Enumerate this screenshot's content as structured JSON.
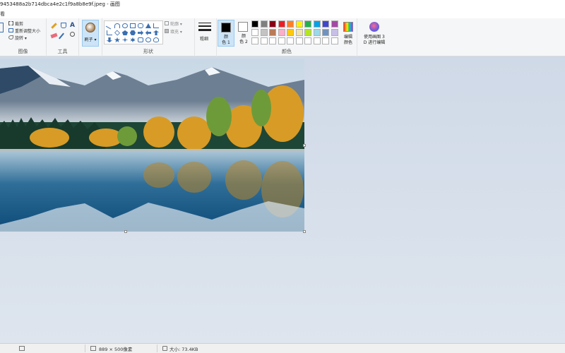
{
  "window": {
    "title": "9453488a2b714dbca4e2c1f9a8b8e9f.jpeg - 画图"
  },
  "menu": {
    "file_label": "看"
  },
  "ribbon": {
    "image_group": {
      "label": "图像",
      "crop": "裁剪",
      "resize": "重新调整大小",
      "rotate": "旋转"
    },
    "tools_group": {
      "label": "工具"
    },
    "brush": {
      "label": "刷子"
    },
    "shapes_group": {
      "label": "形状",
      "outline": "轮廓",
      "fill": "填充"
    },
    "size": {
      "label": "粗细"
    },
    "color1": {
      "label_line1": "颜",
      "label_line2": "色 1",
      "value": "#000000"
    },
    "color2": {
      "label_line1": "颜",
      "label_line2": "色 2",
      "value": "#ffffff"
    },
    "colors_group": {
      "label": "颜色"
    },
    "palette": [
      [
        "#000000",
        "#7f7f7f",
        "#880015",
        "#ed1c24",
        "#ff7f27",
        "#fff200",
        "#22b14c",
        "#00a2e8",
        "#3f48cc",
        "#a349a4"
      ],
      [
        "#ffffff",
        "#c3c3c3",
        "#b97a57",
        "#ffaec9",
        "#ffc90e",
        "#efe4b0",
        "#b5e61d",
        "#99d9ea",
        "#7092be",
        "#c8bfe7"
      ],
      [
        "#ffffff",
        "#ffffff",
        "#ffffff",
        "#ffffff",
        "#ffffff",
        "#ffffff",
        "#ffffff",
        "#ffffff",
        "#ffffff",
        "#ffffff"
      ]
    ],
    "edit_colors": {
      "line1": "编辑",
      "line2": "颜色"
    },
    "paint3d": {
      "line1": "使用画图 3",
      "line2": "D 进行编辑"
    }
  },
  "status": {
    "dimensions": "889 × 500像素",
    "size": "大小: 73.4KB"
  }
}
